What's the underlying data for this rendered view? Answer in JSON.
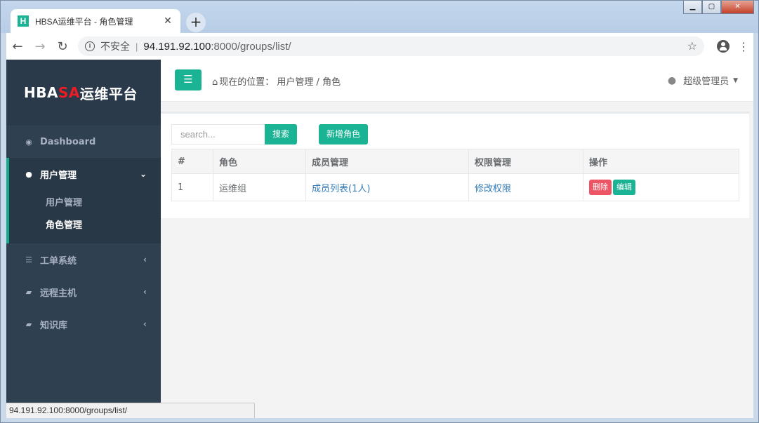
{
  "browser": {
    "tab_title": "HBSA运维平台 - 角色管理",
    "favicon_letter": "H",
    "new_tab": "+",
    "close_tab": "✕",
    "insecure_label": "不安全",
    "url_host": "94.191.92.100",
    "url_rest": ":8000/groups/list/",
    "window_controls": [
      "minimize",
      "maximize",
      "close"
    ],
    "status_url": "94.191.92.100:8000/groups/list/"
  },
  "sidebar": {
    "brand_part1": "HBA",
    "brand_accent": "SA",
    "brand_part2": "运维平台",
    "items": [
      {
        "label": "Dashboard",
        "icon": "dashboard-icon"
      },
      {
        "label": "用户管理",
        "icon": "user-icon",
        "expanded": true,
        "children": [
          {
            "label": "用户管理"
          },
          {
            "label": "角色管理",
            "current": true
          }
        ]
      },
      {
        "label": "工单系统",
        "icon": "server-icon"
      },
      {
        "label": "远程主机",
        "icon": "book-icon"
      },
      {
        "label": "知识库",
        "icon": "book-icon"
      }
    ]
  },
  "header": {
    "breadcrumb_prefix": "现在的位置：",
    "breadcrumb_path": "用户管理 / 角色",
    "user_name": "超级管理员"
  },
  "toolbar": {
    "search_placeholder": "search...",
    "search_button": "搜索",
    "add_button": "新增角色"
  },
  "table": {
    "headers": [
      "#",
      "角色",
      "成员管理",
      "权限管理",
      "操作"
    ],
    "rows": [
      {
        "id": "1",
        "role": "运维组",
        "members": "成员列表(1人)",
        "perms": "修改权限",
        "delete": "删除",
        "edit": "编辑"
      }
    ]
  },
  "colors": {
    "accent": "#1ab394",
    "danger": "#ed5565",
    "sidebar_bg": "#2f4050",
    "brand_red": "#ed1c24"
  }
}
